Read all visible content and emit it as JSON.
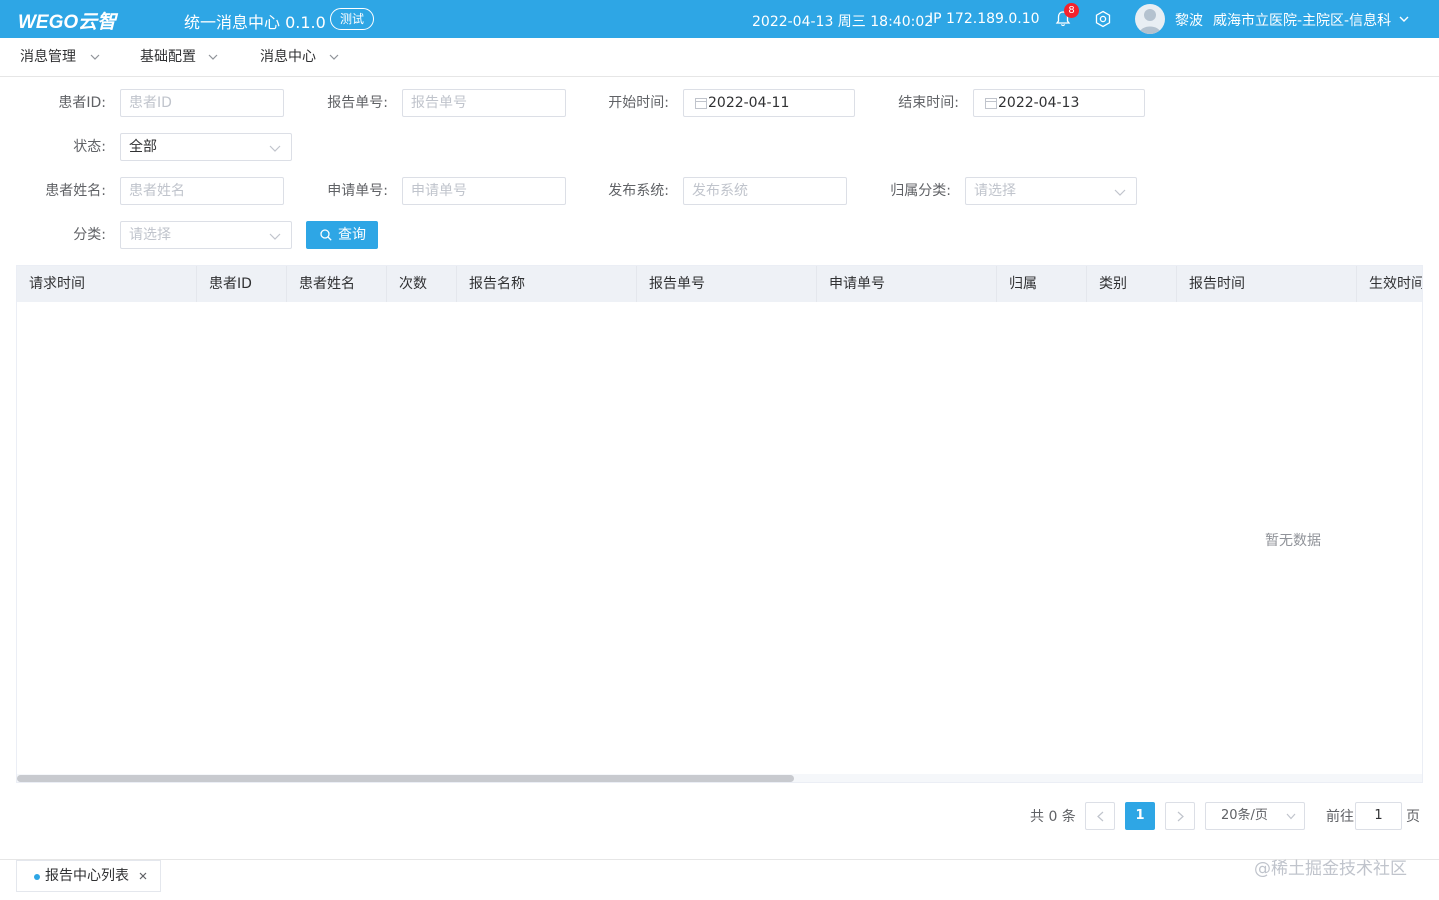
{
  "header": {
    "logo_text": "WEGO云智",
    "app_title": "统一消息中心 0.1.0",
    "env_badge": "测试",
    "datetime": "2022-04-13 周三 18:40:02",
    "ip": "IP 172.189.0.10",
    "notification_count": "8",
    "user_name": "黎波",
    "org_name": "威海市立医院-主院区-信息科",
    "colors": {
      "primary": "#2ea6e5",
      "badge": "#f5222d"
    }
  },
  "nav": {
    "items": [
      {
        "label": "消息管理"
      },
      {
        "label": "基础配置"
      },
      {
        "label": "消息中心"
      }
    ]
  },
  "filters": {
    "patient_id": {
      "label": "患者ID:",
      "placeholder": "患者ID"
    },
    "report_no": {
      "label": "报告单号:",
      "placeholder": "报告单号"
    },
    "start_time": {
      "label": "开始时间:",
      "value": "2022-04-11"
    },
    "end_time": {
      "label": "结束时间:",
      "value": "2022-04-13"
    },
    "status": {
      "label": "状态:",
      "value": "全部"
    },
    "patient_name": {
      "label": "患者姓名:",
      "placeholder": "患者姓名"
    },
    "apply_no": {
      "label": "申请单号:",
      "placeholder": "申请单号"
    },
    "publish_system": {
      "label": "发布系统:",
      "placeholder": "发布系统"
    },
    "belong_category": {
      "label": "归属分类:",
      "placeholder": "请选择"
    },
    "category": {
      "label": "分类:",
      "placeholder": "请选择"
    },
    "query_button": "查询"
  },
  "table": {
    "columns": [
      "请求时间",
      "患者ID",
      "患者姓名",
      "次数",
      "报告名称",
      "报告单号",
      "申请单号",
      "归属",
      "类别",
      "报告时间",
      "生效时间"
    ],
    "rows": [],
    "empty_text": "暂无数据"
  },
  "pagination": {
    "total_text": "共 0 条",
    "current_page": "1",
    "page_size": "20条/页",
    "goto_label": "前往",
    "goto_value": "1",
    "goto_unit": "页"
  },
  "bottom_tabs": [
    {
      "label": "报告中心列表"
    }
  ],
  "watermark": "@稀土掘金技术社区"
}
